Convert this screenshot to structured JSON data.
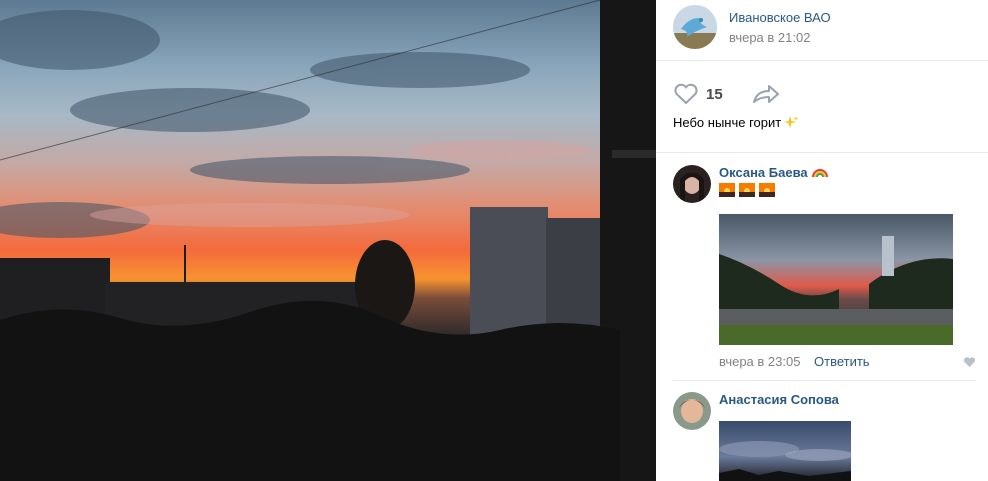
{
  "post": {
    "group_name": "Ивановское ВАО",
    "time": "вчера в 21:02",
    "likes": "15",
    "text": "Небо нынче горит"
  },
  "comments": [
    {
      "author": "Оксана Баева",
      "time": "вчера в 23:05",
      "reply_label": "Ответить"
    },
    {
      "author": "Анастасия Сопова"
    }
  ],
  "icons": {
    "like": "heart-icon",
    "share": "share-arrow-icon",
    "sparkles": "sparkles-emoji",
    "rainbow": "rainbow-emoji",
    "sunset": "sunset-emoji"
  },
  "colors": {
    "link": "#2a5885",
    "muted": "#828282"
  }
}
